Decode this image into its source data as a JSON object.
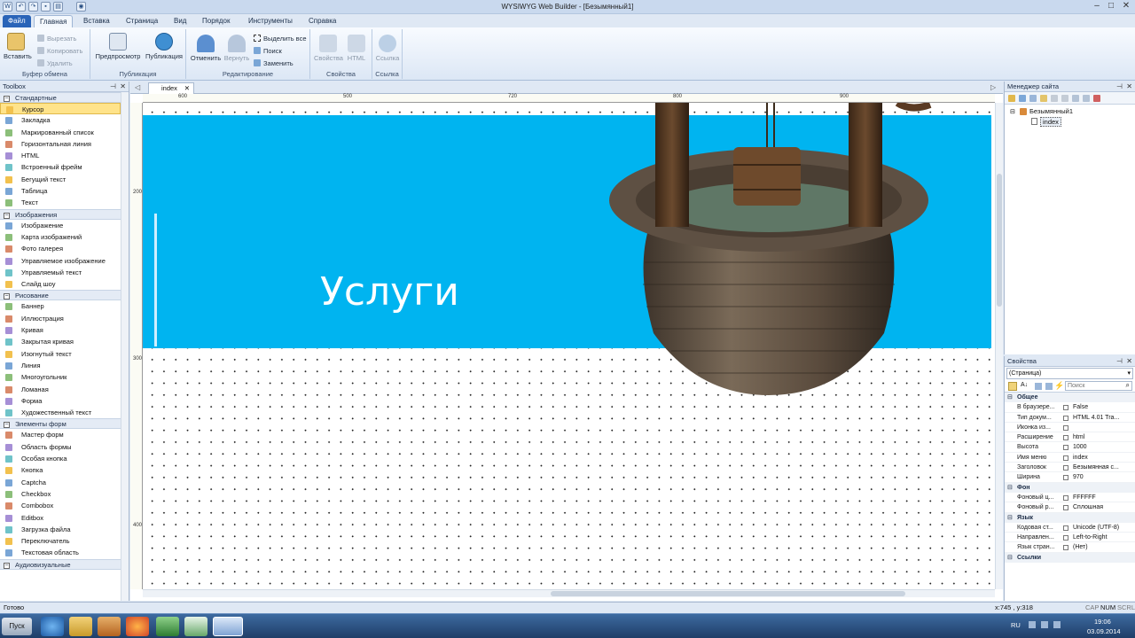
{
  "window": {
    "title": "WYSIWYG Web Builder - [Безымянный1]"
  },
  "menu_tabs": [
    "Файл",
    "Главная",
    "Вставка",
    "Страница",
    "Вид",
    "Порядок",
    "Инструменты",
    "Справка"
  ],
  "ribbon": {
    "clipboard": {
      "paste": "Вставить",
      "cut": "Вырезать",
      "copy": "Копировать",
      "delete": "Удалить",
      "label": "Буфер обмена"
    },
    "publish": {
      "preview": "Предпросмотр",
      "publish": "Публикация",
      "label": "Публикация"
    },
    "edit": {
      "undo": "Отменить",
      "redo": "Вернуть",
      "select_all": "Выделить все",
      "find": "Поиск",
      "replace": "Заменить",
      "label": "Редактирование"
    },
    "properties": {
      "props": "Свойства",
      "html": "HTML",
      "label": "Свойства"
    },
    "link": {
      "link": "Ссылка",
      "label": "Ссылка"
    }
  },
  "toolbox": {
    "title": "Toolbox",
    "sections": [
      {
        "name": "Стандартные",
        "items": [
          "Курсор",
          "Закладка",
          "Маркированный список",
          "Горизонтальная линия",
          "HTML",
          "Встроенный фрейм",
          "Бегущий текст",
          "Таблица",
          "Текст"
        ]
      },
      {
        "name": "Изображения",
        "items": [
          "Изображение",
          "Карта изображений",
          "Фото галерея",
          "Управляемое изображение",
          "Управляемый текст",
          "Слайд шоу"
        ]
      },
      {
        "name": "Рисование",
        "items": [
          "Баннер",
          "Иллюстрация",
          "Кривая",
          "Закрытая кривая",
          "Изогнутый текст",
          "Линия",
          "Многоугольник",
          "Ломаная",
          "Форма",
          "Художественный текст"
        ]
      },
      {
        "name": "Элементы форм",
        "items": [
          "Мастер форм",
          "Область формы",
          "Особая кнопка",
          "Кнопка",
          "Captcha",
          "Checkbox",
          "Combobox",
          "Editbox",
          "Загрузка файла",
          "Переключатель",
          "Текстовая область"
        ]
      },
      {
        "name": "Аудиовизуальные",
        "items": []
      }
    ]
  },
  "document": {
    "tab": "index",
    "banner_text": "Услуги"
  },
  "rulers": {
    "h": [
      "600",
      "500",
      "720",
      "800",
      "900"
    ],
    "v": [
      "200",
      "300",
      "400"
    ]
  },
  "site_manager": {
    "title": "Менеджер сайта",
    "root": "Безымянный1",
    "page": "index"
  },
  "properties": {
    "title": "Свойства",
    "selector": "(Страница)",
    "search_placeholder": "Поиск",
    "groups": [
      {
        "name": "Общее",
        "rows": [
          [
            "В браузере...",
            "False"
          ],
          [
            "Тип докум...",
            "HTML 4.01 Tra..."
          ],
          [
            "Иконка из...",
            ""
          ],
          [
            "Расширение",
            "html"
          ],
          [
            "Высота",
            "1000"
          ],
          [
            "Имя меню",
            "index"
          ],
          [
            "Заголовок",
            "Безымянная с..."
          ],
          [
            "Ширина",
            "970"
          ]
        ]
      },
      {
        "name": "Фон",
        "rows": [
          [
            "Фоновый ц...",
            "FFFFFF"
          ],
          [
            "Фоновый р...",
            "Сплошная"
          ]
        ]
      },
      {
        "name": "Язык",
        "rows": [
          [
            "Кодовая ст...",
            "Unicode (UTF-8)"
          ],
          [
            "Направлен...",
            "Left-to-Right"
          ],
          [
            "Язык стран...",
            "(Нет)"
          ]
        ]
      },
      {
        "name": "Ссылки",
        "rows": []
      }
    ]
  },
  "status": {
    "left": "Готово",
    "coords": "x:745 , y:318",
    "caps": "CAP",
    "num": "NUM",
    "scrl": "SCRL"
  },
  "taskbar": {
    "start": "Пуск",
    "lang": "RU",
    "time": "19:06",
    "date": "03.09.2014"
  },
  "colors": {
    "banner": "#00b4f0",
    "ribbon_accent": "#2a64b8"
  }
}
